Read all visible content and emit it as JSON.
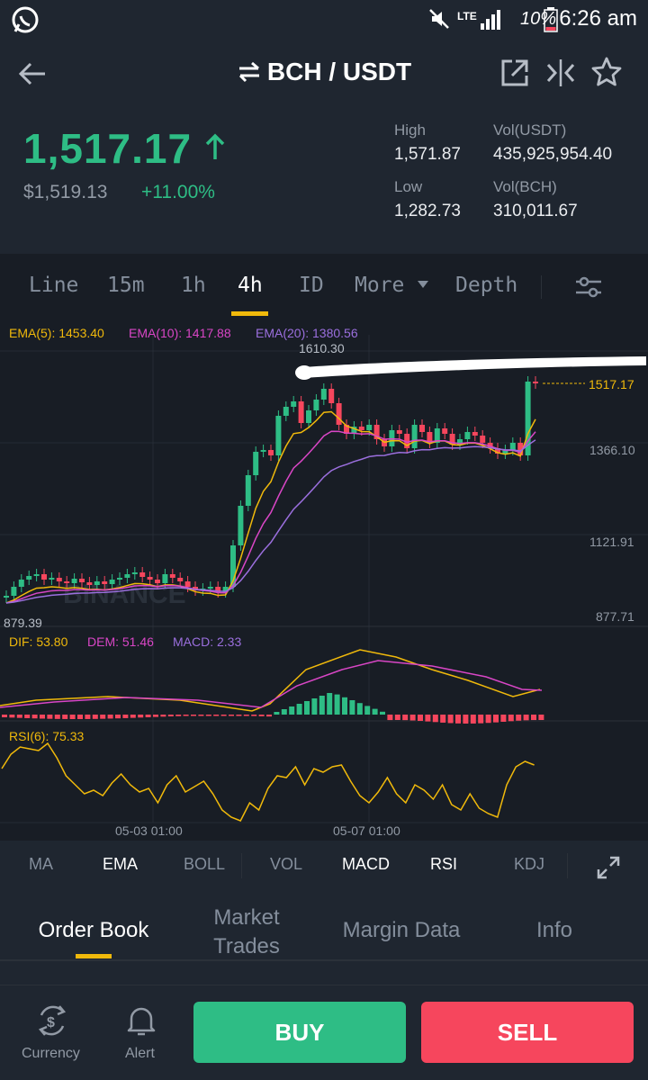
{
  "status_bar": {
    "battery": "10%",
    "time": "6:26 am"
  },
  "header": {
    "pair": "BCH / USDT"
  },
  "ticker": {
    "last_price": "1,517.17",
    "usd_price": "$1,519.13",
    "change": "+11.00%",
    "high_label": "High",
    "high": "1,571.87",
    "low_label": "Low",
    "low": "1,282.73",
    "vol_usdt_label": "Vol(USDT)",
    "vol_usdt": "435,925,954.40",
    "vol_bch_label": "Vol(BCH)",
    "vol_bch": "310,011.67"
  },
  "interval_tabs": [
    "Line",
    "15m",
    "1h",
    "4h",
    "ID",
    "More",
    "Depth"
  ],
  "active_interval": "4h",
  "legend": {
    "ema5": "EMA(5): 1453.40",
    "ema10": "EMA(10): 1417.88",
    "ema20": "EMA(20): 1380.56",
    "macd_dif": "DIF: 53.80",
    "macd_dem": "DEM: 51.46",
    "macd_val": "MACD: 2.33",
    "rsi": "RSI(6): 75.33"
  },
  "price_axis": [
    "1366.10",
    "1121.91",
    "877.71"
  ],
  "max_label": "1610.30",
  "min_label": "879.39",
  "current_price_tag": "1517.17",
  "watermark": "BINANCE",
  "time_axis": [
    "05-03 01:00",
    "05-07 01:00"
  ],
  "indicator_buttons": [
    "MA",
    "EMA",
    "BOLL",
    "VOL",
    "MACD",
    "RSI",
    "KDJ"
  ],
  "bottom_tabs": [
    "Order Book",
    "Market Trades",
    "Margin Data",
    "Info"
  ],
  "footer": {
    "currency_label": "Currency",
    "alert_label": "Alert",
    "buy_label": "BUY",
    "sell_label": "SELL"
  },
  "colors": {
    "up": "#2ebd85",
    "down": "#f6465d",
    "ema5": "#f0b90b",
    "ema10": "#d946c6",
    "ema20": "#9b6fde",
    "accent": "#f0b90b"
  }
}
